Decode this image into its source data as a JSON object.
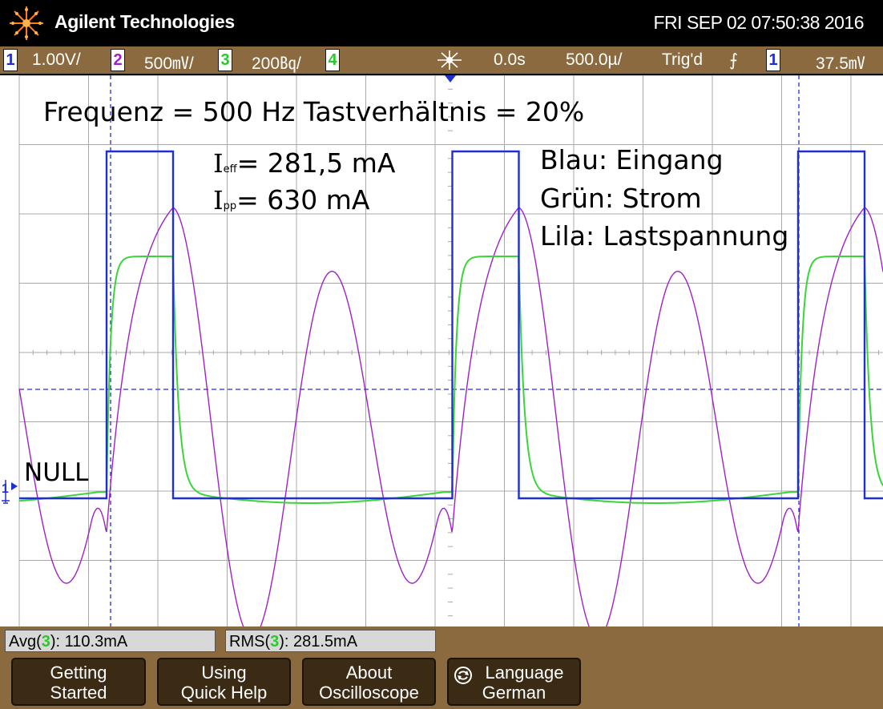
{
  "header": {
    "brand": "Agilent Technologies",
    "datetime": "FRI SEP 02 07:50:38 2016",
    "logo_icon": "agilent-spark-logo-icon"
  },
  "status": {
    "ch1_num": "1",
    "ch1_scale": "1.00V/",
    "ch2_num": "2",
    "ch2_scale": "500㎷/",
    "ch3_num": "3",
    "ch3_scale": "200㏃/",
    "ch4_num": "4",
    "run_icon": "acquisition-spark-icon",
    "time_offset": "0.0s",
    "timebase": "500.0µ/",
    "trig_status": "Trig'd",
    "trig_edge": "⨍",
    "trig_source": "1",
    "trig_level": "37.5㎷"
  },
  "annotations": {
    "freq": "Frequenz = 500 Hz Tastverhältnis = 20%",
    "ieff_sym": "I",
    "ieff_sub": "eff",
    "ieff_val": "= 281,5 mA",
    "ipp_sym": "I",
    "ipp_sub": "pp",
    "ipp_val": "= 630 mA",
    "blue": "Blau: Eingang",
    "green": "Grün: Strom",
    "lila": "Lila: Lastspannung",
    "null": "NULL"
  },
  "ground_marker": "1",
  "measurements": {
    "avg_label": "Avg(",
    "avg_ch": "3",
    "avg_value": "): 110.3mA",
    "rms_label": "RMS(",
    "rms_ch": "3",
    "rms_value": "): 281.5mA"
  },
  "softkeys": {
    "getting_started": [
      "Getting",
      "Started"
    ],
    "quick_help": [
      "Using",
      "Quick Help"
    ],
    "about": [
      "About",
      "Oscilloscope"
    ],
    "language": [
      "Language",
      "German"
    ],
    "language_icon": "refresh-arrow-icon"
  },
  "colors": {
    "blue": "#1f2fd0",
    "green": "#39d639",
    "purple": "#a020c8",
    "grid": "#a8a8a8",
    "panel": "#8b6a3f",
    "key": "#3b2a14"
  }
}
